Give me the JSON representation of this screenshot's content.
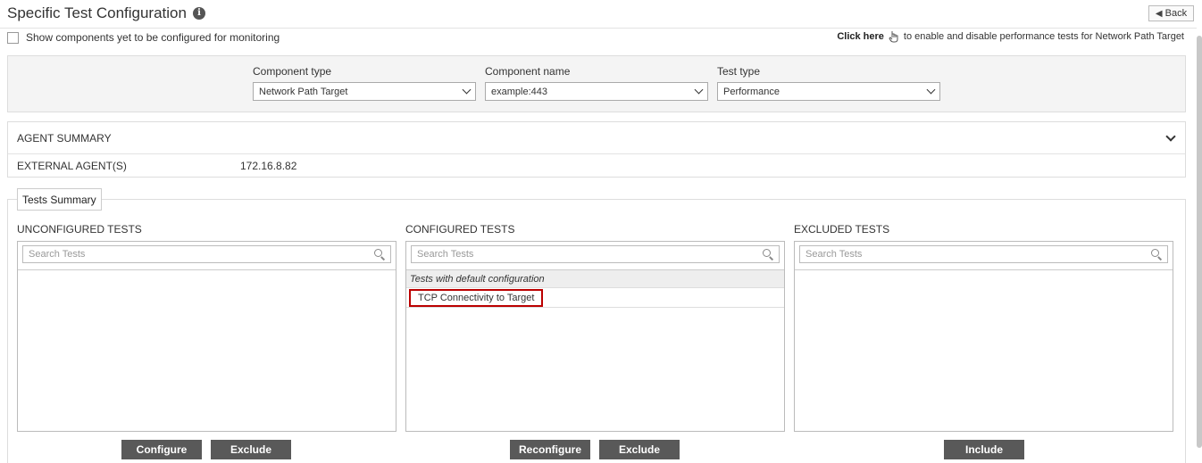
{
  "header": {
    "title": "Specific Test Configuration",
    "info_icon": "i",
    "back_label": "Back"
  },
  "show_components": {
    "label": "Show components yet to be configured for monitoring",
    "checked": false
  },
  "click_note": {
    "link": "Click here",
    "text": "to enable and disable performance tests for Network Path Target"
  },
  "filters": {
    "component_type": {
      "label": "Component type",
      "value": "Network Path Target"
    },
    "component_name": {
      "label": "Component name",
      "value": "example:443"
    },
    "test_type": {
      "label": "Test type",
      "value": "Performance"
    }
  },
  "agent_summary": {
    "title": "AGENT SUMMARY",
    "key": "EXTERNAL AGENT(S)",
    "value": "172.16.8.82"
  },
  "tests_summary": {
    "tab_label": "Tests Summary",
    "unconfigured": {
      "title": "UNCONFIGURED TESTS",
      "placeholder": "Search Tests",
      "buttons": [
        "Configure",
        "Exclude"
      ]
    },
    "configured": {
      "title": "CONFIGURED TESTS",
      "placeholder": "Search Tests",
      "group": "Tests with default configuration",
      "items": [
        "TCP Connectivity to Target"
      ],
      "buttons": [
        "Reconfigure",
        "Exclude"
      ]
    },
    "excluded": {
      "title": "EXCLUDED TESTS",
      "placeholder": "Search Tests",
      "buttons": [
        "Include"
      ]
    }
  },
  "colors": {
    "button_bg": "#595959",
    "selected_border": "#bb0000"
  }
}
